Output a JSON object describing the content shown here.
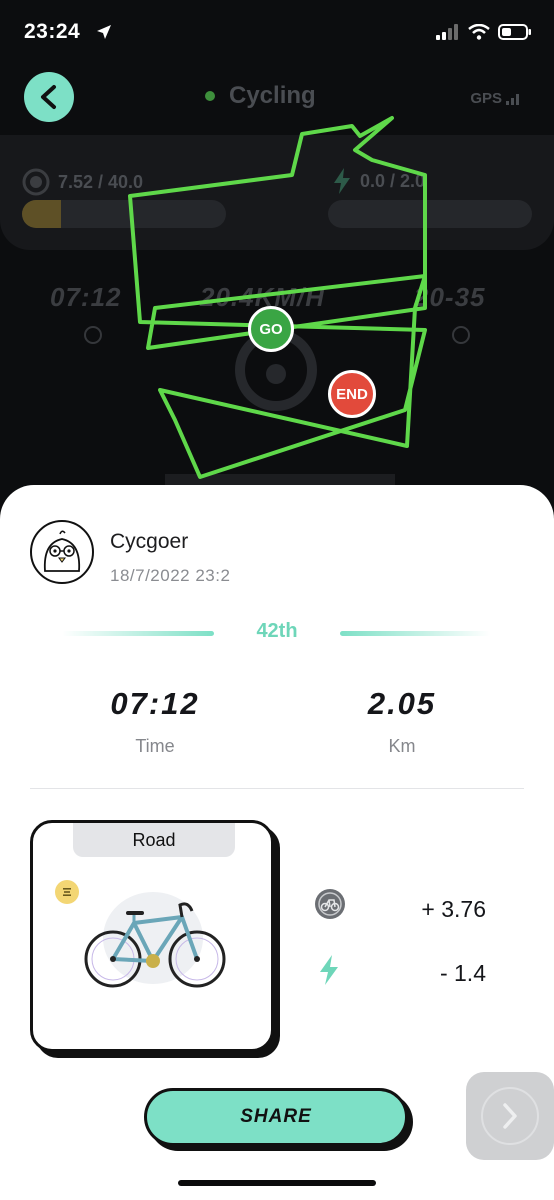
{
  "status_bar": {
    "time": "23:24"
  },
  "header": {
    "mode": "Cycling",
    "gps": "GPS"
  },
  "stats": {
    "currency": "7.52 / 40.0",
    "energy": "0.0 / 2.0",
    "currency_progress": 0.19,
    "energy_progress": 0.0
  },
  "live": {
    "time": "07:12",
    "speed": "20.4KM/H",
    "range": "20-35"
  },
  "route": {
    "start_label": "GO",
    "end_label": "END"
  },
  "user": {
    "name": "Cycgoer",
    "date": "18/7/2022 23:2"
  },
  "rank": "42th",
  "summary": {
    "time_value": "07:12",
    "time_label": "Time",
    "distance_value": "2.05",
    "distance_label": "Km"
  },
  "bike": {
    "type": "Road"
  },
  "rewards": {
    "coin": "+ 3.76",
    "energy": "- 1.4"
  },
  "actions": {
    "share": "SHARE"
  },
  "colors": {
    "accent": "#7de0c6",
    "route": "#5fd84a",
    "go": "#3aa544",
    "end": "#e24a3b"
  }
}
